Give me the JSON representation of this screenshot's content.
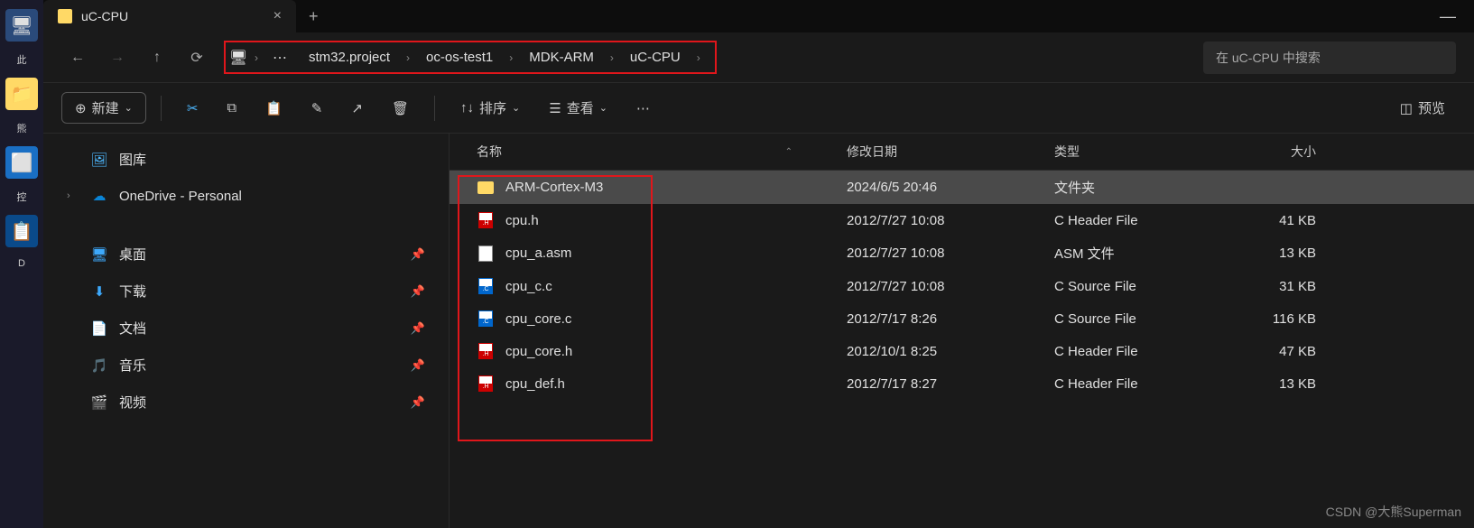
{
  "desktop": {
    "items": [
      {
        "label": "此"
      },
      {
        "label": ""
      },
      {
        "label": "熊"
      },
      {
        "label": ""
      },
      {
        "label": "控"
      },
      {
        "label": ""
      },
      {
        "label": "D"
      }
    ]
  },
  "tab": {
    "title": "uC-CPU",
    "close": "×",
    "new": "+"
  },
  "nav": {
    "back": "←",
    "forward": "→",
    "up": "↑",
    "refresh": "⟳"
  },
  "breadcrumb": {
    "more": "⋯",
    "items": [
      "stm32.project",
      "oc-os-test1",
      "MDK-ARM",
      "uC-CPU"
    ]
  },
  "search": {
    "placeholder": "在 uC-CPU 中搜索"
  },
  "toolbar": {
    "new": "新建",
    "sort": "排序",
    "view": "查看",
    "preview": "预览"
  },
  "sidebar": {
    "gallery": "图库",
    "onedrive": "OneDrive - Personal",
    "items": [
      {
        "icon": "desktop",
        "label": "桌面",
        "color": "#3da9fc"
      },
      {
        "icon": "download",
        "label": "下载",
        "color": "#3da9fc"
      },
      {
        "icon": "document",
        "label": "文档",
        "color": "#6b7cff"
      },
      {
        "icon": "music",
        "label": "音乐",
        "color": "#e04f8a"
      },
      {
        "icon": "video",
        "label": "视频",
        "color": "#8a4fe0"
      }
    ]
  },
  "columns": {
    "name": "名称",
    "date": "修改日期",
    "type": "类型",
    "size": "大小"
  },
  "files": [
    {
      "name": "ARM-Cortex-M3",
      "date": "2024/6/5 20:46",
      "type": "文件夹",
      "size": "",
      "icon": "folder",
      "selected": true
    },
    {
      "name": "cpu.h",
      "date": "2012/7/27 10:08",
      "type": "C Header File",
      "size": "41 KB",
      "icon": "h"
    },
    {
      "name": "cpu_a.asm",
      "date": "2012/7/27 10:08",
      "type": "ASM 文件",
      "size": "13 KB",
      "icon": "asm"
    },
    {
      "name": "cpu_c.c",
      "date": "2012/7/27 10:08",
      "type": "C Source File",
      "size": "31 KB",
      "icon": "c"
    },
    {
      "name": "cpu_core.c",
      "date": "2012/7/17 8:26",
      "type": "C Source File",
      "size": "116 KB",
      "icon": "c"
    },
    {
      "name": "cpu_core.h",
      "date": "2012/10/1 8:25",
      "type": "C Header File",
      "size": "47 KB",
      "icon": "h"
    },
    {
      "name": "cpu_def.h",
      "date": "2012/7/17 8:27",
      "type": "C Header File",
      "size": "13 KB",
      "icon": "h"
    }
  ],
  "watermark": "CSDN @大熊Superman"
}
